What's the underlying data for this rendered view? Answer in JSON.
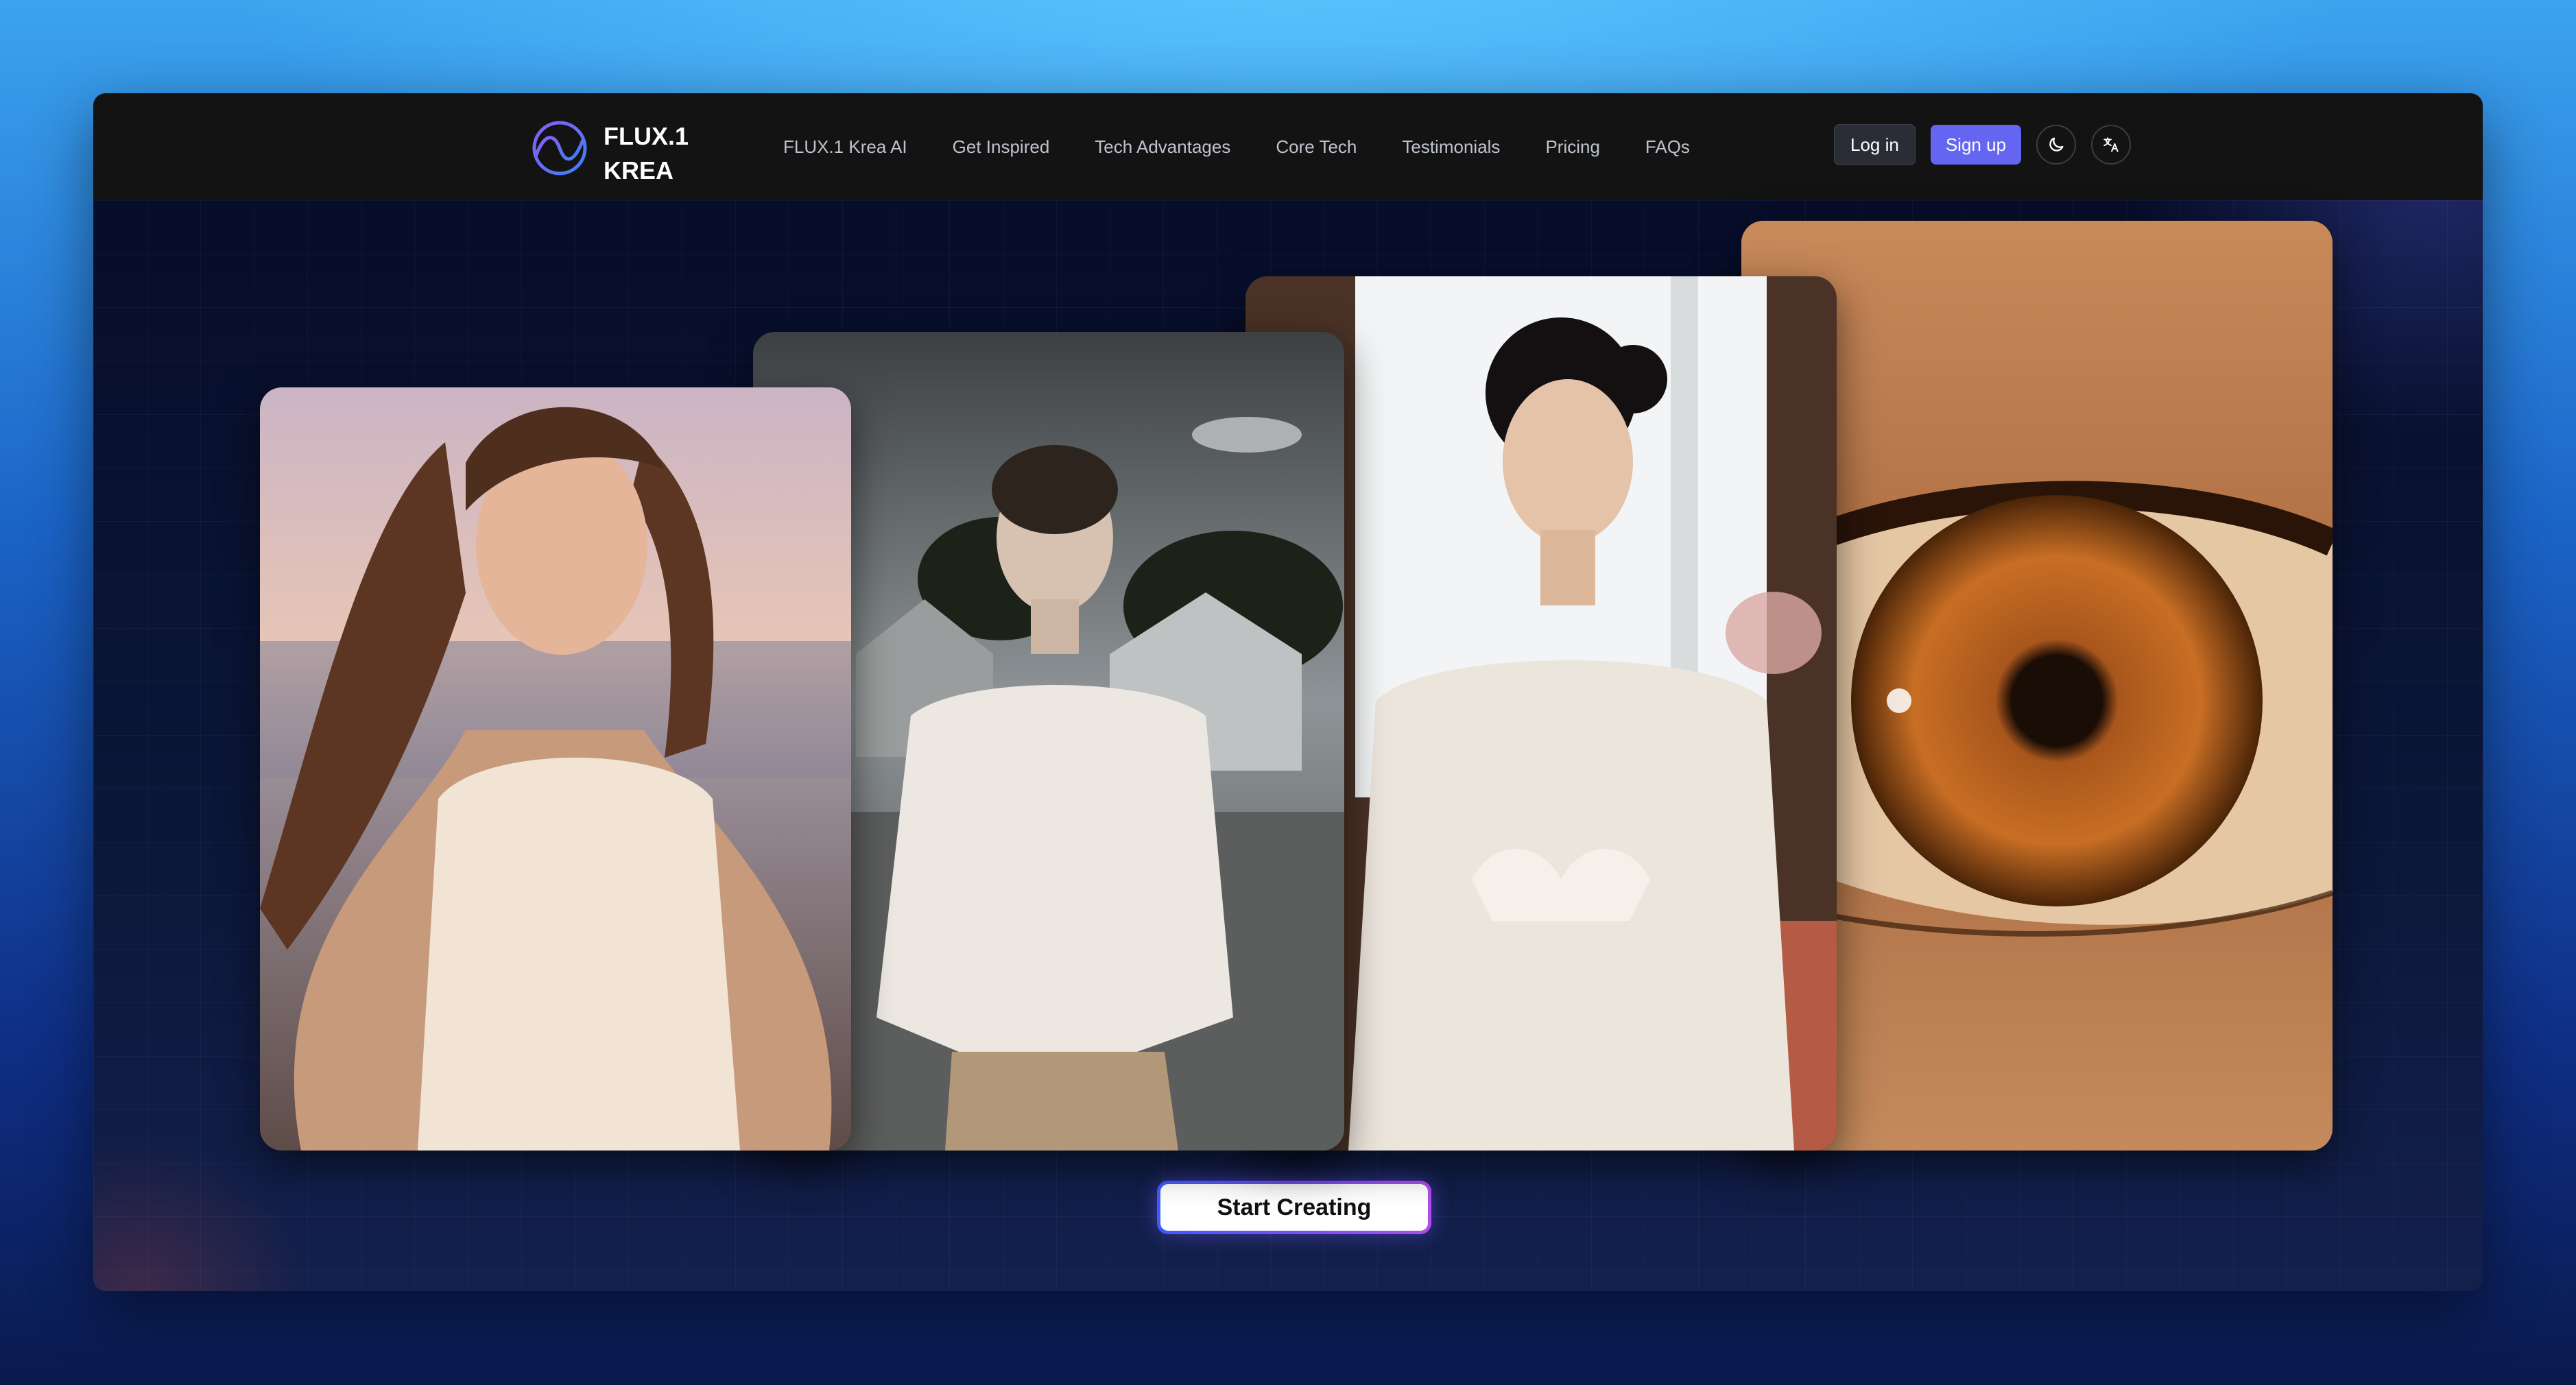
{
  "colors": {
    "page_background": "#1b64c7",
    "navbar_background": "#131313",
    "accent": "#6466f1",
    "cta_gradient": [
      "#3b5bff",
      "#7c4dff",
      "#b14cf0"
    ]
  },
  "navbar": {
    "logo": {
      "line1": "FLUX.1",
      "line2": "KREA",
      "icon": "flux-wave-logo"
    },
    "links": [
      {
        "label": "FLUX.1 Krea AI"
      },
      {
        "label": "Get Inspired"
      },
      {
        "label": "Tech Advantages"
      },
      {
        "label": "Core Tech"
      },
      {
        "label": "Testimonials"
      },
      {
        "label": "Pricing"
      },
      {
        "label": "FAQs"
      }
    ],
    "login_label": "Log in",
    "signup_label": "Sign up",
    "theme_icon": "moon-icon",
    "language_icon": "translate-icon"
  },
  "gallery": {
    "images": [
      {
        "name": "woman-windblown-hair-sunset"
      },
      {
        "name": "woman-buzzcut-white-sweater"
      },
      {
        "name": "woman-lace-dress-window"
      },
      {
        "name": "eye-closeup"
      }
    ]
  },
  "cta": {
    "label": "Start Creating"
  }
}
